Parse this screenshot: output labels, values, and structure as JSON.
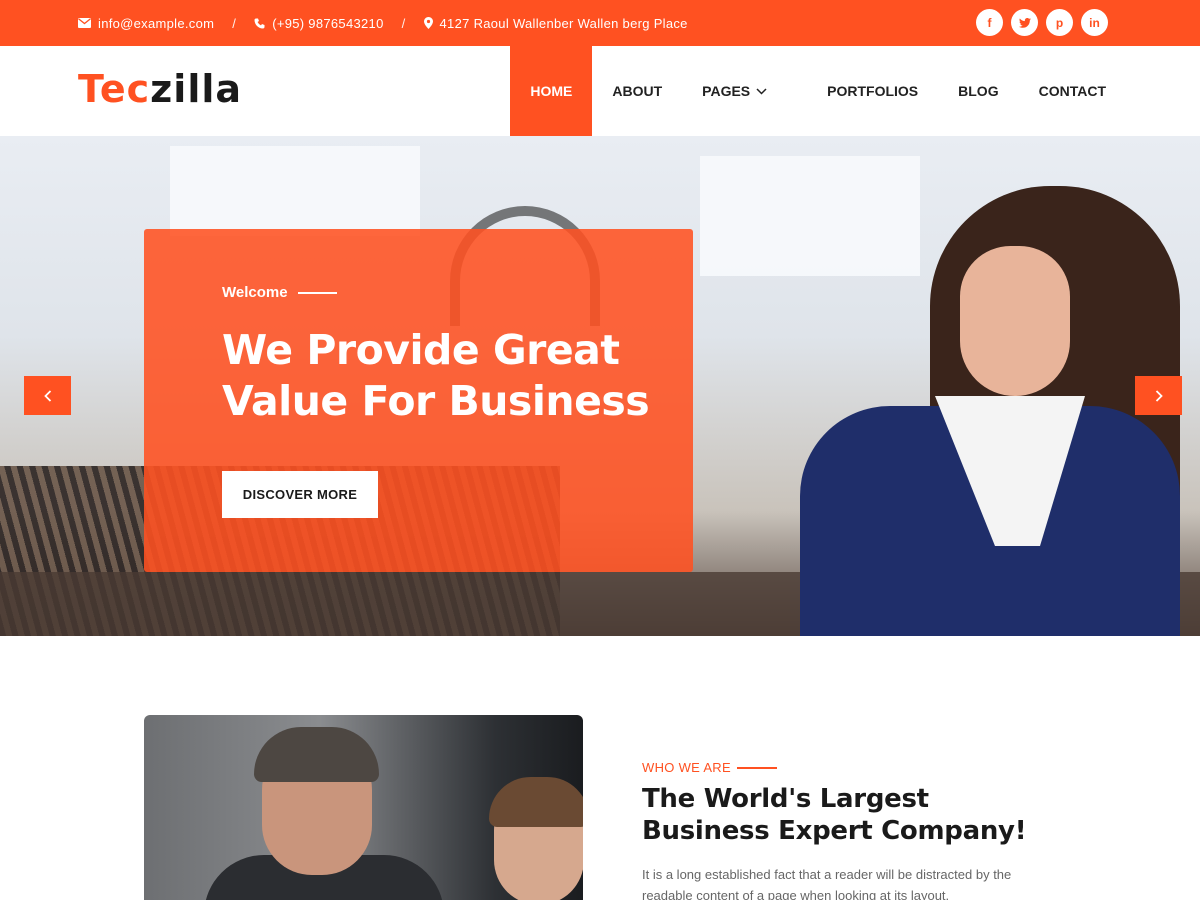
{
  "topbar": {
    "email": "info@example.com",
    "phone": "(+95) 9876543210",
    "address": "4127 Raoul Wallenber Wallen berg Place",
    "separator": "/",
    "social": [
      {
        "icon": "facebook-icon",
        "glyph": "f"
      },
      {
        "icon": "twitter-icon",
        "glyph": "t"
      },
      {
        "icon": "pinterest-icon",
        "glyph": "p"
      },
      {
        "icon": "linkedin-icon",
        "glyph": "in"
      }
    ]
  },
  "header": {
    "logo_part1": "Tec",
    "logo_part2": "zilla",
    "nav": [
      {
        "label": "HOME",
        "active": true
      },
      {
        "label": "ABOUT",
        "active": false
      },
      {
        "label": "PAGES",
        "active": false,
        "dropdown": true
      },
      {
        "label": "PORTFOLIOS",
        "active": false
      },
      {
        "label": "BLOG",
        "active": false
      },
      {
        "label": "CONTACT",
        "active": false
      }
    ]
  },
  "hero": {
    "welcome": "Welcome",
    "headline": "We Provide Great Value For Business",
    "cta": "DISCOVER MORE",
    "prev_icon": "chevron-left-icon",
    "next_icon": "chevron-right-icon"
  },
  "about": {
    "eyebrow": "WHO WE ARE",
    "title": "The World's Largest Business Expert Company!",
    "description": "It is a long established fact that a reader will be distracted by the readable content of a page when looking at its layout."
  },
  "colors": {
    "accent": "#ff5121",
    "text": "#1a1a1a",
    "muted": "#666666"
  }
}
